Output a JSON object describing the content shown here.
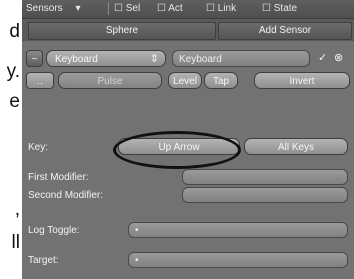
{
  "document": {
    "fragments": [
      "d",
      "y.",
      "e",
      ",",
      "ll"
    ]
  },
  "sensor_header": {
    "mode_label": "Sensors",
    "toggles": [
      {
        "label": "Sel"
      },
      {
        "label": "Act"
      },
      {
        "label": "Link"
      },
      {
        "label": "State"
      }
    ]
  },
  "tabs": {
    "object_tab": "Sphere",
    "add_sensor": "Add Sensor"
  },
  "sensor": {
    "type_dropdown": "Keyboard",
    "name_field": "Keyboard",
    "row2": {
      "pulse_label": "Pulse",
      "level_label": "Level",
      "tap_label": "Tap",
      "invert_label": "Invert"
    },
    "key_label": "Key:",
    "key_value": "Up Arrow",
    "all_keys_label": "All Keys",
    "first_modifier_label": "First Modifier:",
    "second_modifier_label": "Second Modifier:",
    "log_toggle_label": "Log Toggle:",
    "target_label": "Target:",
    "log_toggle_value": "",
    "target_value": ""
  },
  "colors": {
    "panel_bg": "#727272",
    "header_bg": "#555555",
    "annotation": "#111111"
  }
}
